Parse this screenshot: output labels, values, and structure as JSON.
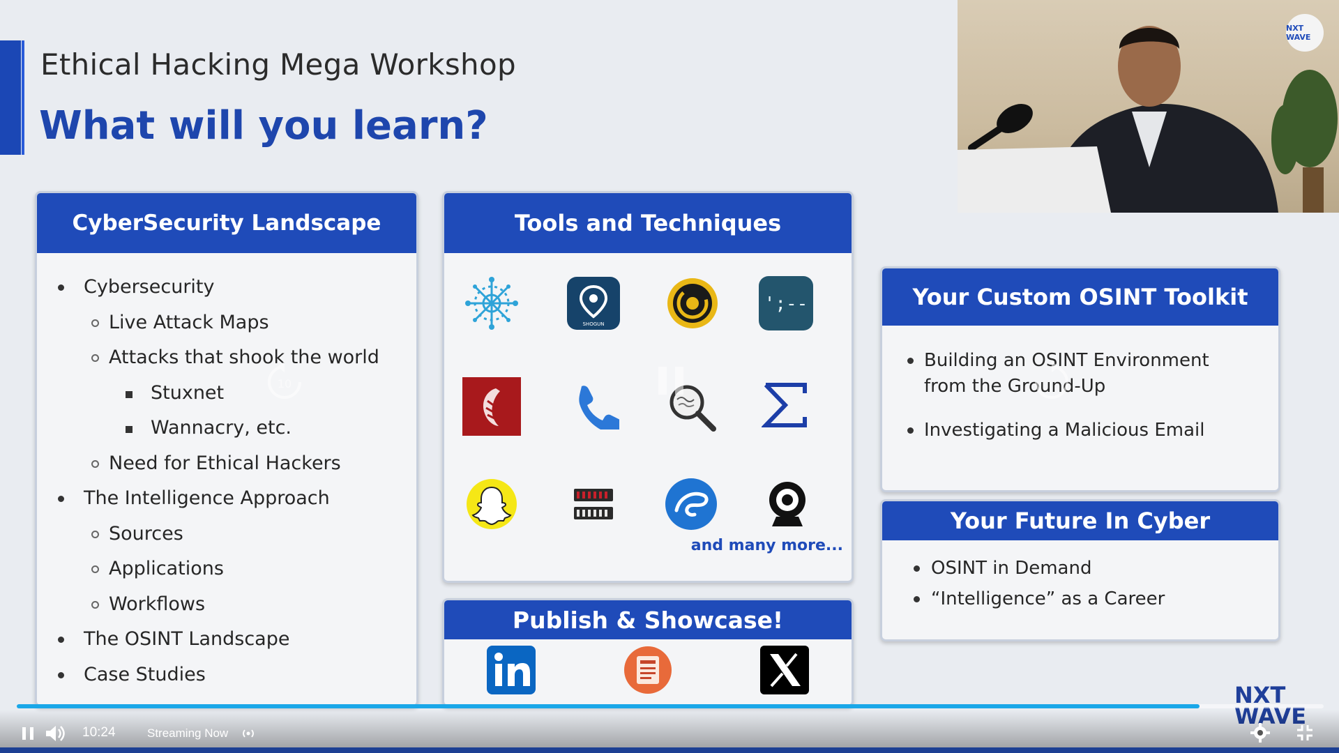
{
  "slide": {
    "workshop_title": "Ethical Hacking Mega Workshop",
    "heading": "What will you learn?",
    "cybersecurity_card": {
      "title": "CyberSecurity Landscape",
      "items": [
        {
          "level": 1,
          "text": "Cybersecurity"
        },
        {
          "level": 2,
          "text": "Live Attack Maps"
        },
        {
          "level": 2,
          "text": "Attacks that shook the world"
        },
        {
          "level": 3,
          "text": "Stuxnet"
        },
        {
          "level": 3,
          "text": "Wannacry, etc."
        },
        {
          "level": 2,
          "text": "Need for Ethical Hackers"
        },
        {
          "level": 1,
          "text": "The Intelligence Approach"
        },
        {
          "level": 2,
          "text": "Sources"
        },
        {
          "level": 2,
          "text": "Applications"
        },
        {
          "level": 2,
          "text": "Workflows"
        },
        {
          "level": 1,
          "text": "The OSINT Landscape"
        },
        {
          "level": 1,
          "text": "Case Studies"
        }
      ]
    },
    "tools_card": {
      "title": "Tools and Techniques",
      "tools": [
        "network-cluster-icon",
        "location-pin-app-icon",
        "target-spiral-icon",
        "terminal-prompt-icon",
        "red-hand-logo-icon",
        "phone-icon",
        "magnifier-search-icon",
        "sigma-icon",
        "snapchat-icon",
        "wayback-machine-icon",
        "blue-swirl-logo-icon",
        "webcam-icon"
      ],
      "tool_label_text": {
        "location_pin": "SHOGUN",
        "terminal": "';--"
      },
      "more_text": "and many more..."
    },
    "publish_card": {
      "title": "Publish & Showcase!",
      "platforms": [
        "linkedin-icon",
        "article-icon",
        "x-twitter-icon"
      ]
    },
    "osint_card": {
      "title": "Your Custom OSINT Toolkit",
      "bullets": [
        "Building an OSINT Environment from the Ground-Up",
        "Investigating a Malicious Email"
      ]
    },
    "future_card": {
      "title": "Your Future In Cyber",
      "bullets": [
        "OSINT in Demand",
        "“Intelligence” as a Career"
      ]
    },
    "brand_logo": {
      "line1": "NXT",
      "line2": "WAVE"
    },
    "webcam_badge": "NXT WAVE"
  },
  "player": {
    "time": "10:24",
    "status": "Streaming Now",
    "progress": 0.905,
    "colors": {
      "progress": "#1aa7e8",
      "accent": "#1f4bb9"
    }
  }
}
